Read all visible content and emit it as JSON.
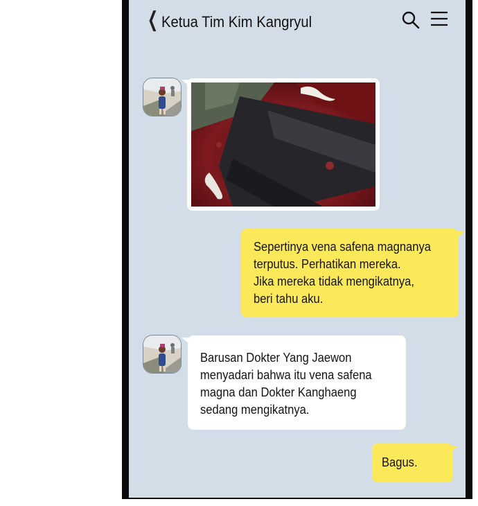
{
  "header": {
    "back_icon": "chevron-left-icon",
    "title": "Ketua Tim Kim Kangryul",
    "search_icon": "search-icon",
    "menu_icon": "hamburger-menu-icon"
  },
  "messages": [
    {
      "sender": "contact",
      "type": "image"
    },
    {
      "sender": "me",
      "type": "text",
      "text": "Sepertinya vena safena magnanya\nterputus. Perhatikan mereka.\nJika mereka tidak mengikatnya,\nberi tahu aku."
    },
    {
      "sender": "contact",
      "type": "text",
      "text": "Barusan Dokter Yang Jaewon\nmenyadari bahwa itu vena safena\nmagna dan Dokter Kanghaeng\nsedang mengikatnya."
    },
    {
      "sender": "me",
      "type": "text",
      "text": "Bagus."
    }
  ],
  "colors": {
    "chat_background": "#d2dde8",
    "outgoing_bubble": "#fbe95a",
    "incoming_bubble": "#ffffff",
    "phone_frame": "#0a0a0a"
  }
}
